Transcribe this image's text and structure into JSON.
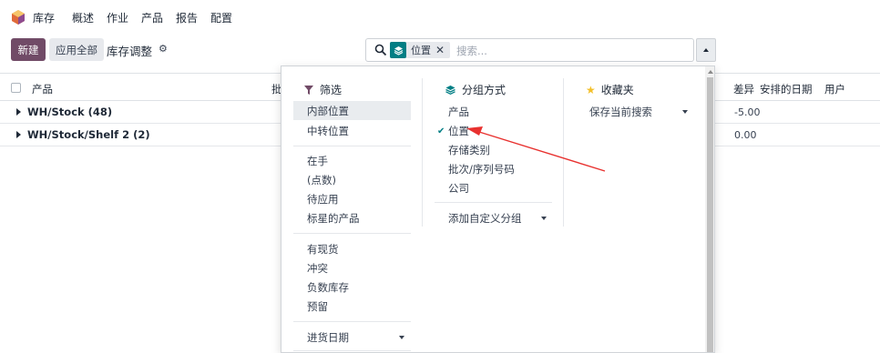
{
  "navbar": {
    "app_name": "库存",
    "menus": [
      "概述",
      "作业",
      "产品",
      "报告",
      "配置"
    ]
  },
  "control_panel": {
    "new_label": "新建",
    "apply_all_label": "应用全部",
    "title": "库存调整"
  },
  "search": {
    "facet_label": "位置",
    "placeholder": "搜索..."
  },
  "list": {
    "headers": {
      "product": "产品",
      "batch_partial": "批",
      "difference": "差异",
      "scheduled_date": "安排的日期",
      "user": "用户"
    },
    "groups": [
      {
        "name": "WH/Stock (48)",
        "difference": "-5.00"
      },
      {
        "name": "WH/Stock/Shelf 2 (2)",
        "difference": "0.00"
      }
    ]
  },
  "dropdown": {
    "filters": {
      "title": "筛选",
      "items": [
        "内部位置",
        "中转位置",
        "在手",
        "(点数)",
        "待应用",
        "标星的产品",
        "有现货",
        "冲突",
        "负数库存",
        "预留",
        "进货日期"
      ]
    },
    "group_by": {
      "title": "分组方式",
      "items": [
        "产品",
        "位置",
        "存储类别",
        "批次/序列号码",
        "公司"
      ],
      "add_custom": "添加自定义分组"
    },
    "favorites": {
      "title": "收藏夹",
      "save_current": "保存当前搜索"
    }
  },
  "colors": {
    "brand": "#714b67",
    "accent": "#017e84",
    "arrow": "#e8312f"
  }
}
